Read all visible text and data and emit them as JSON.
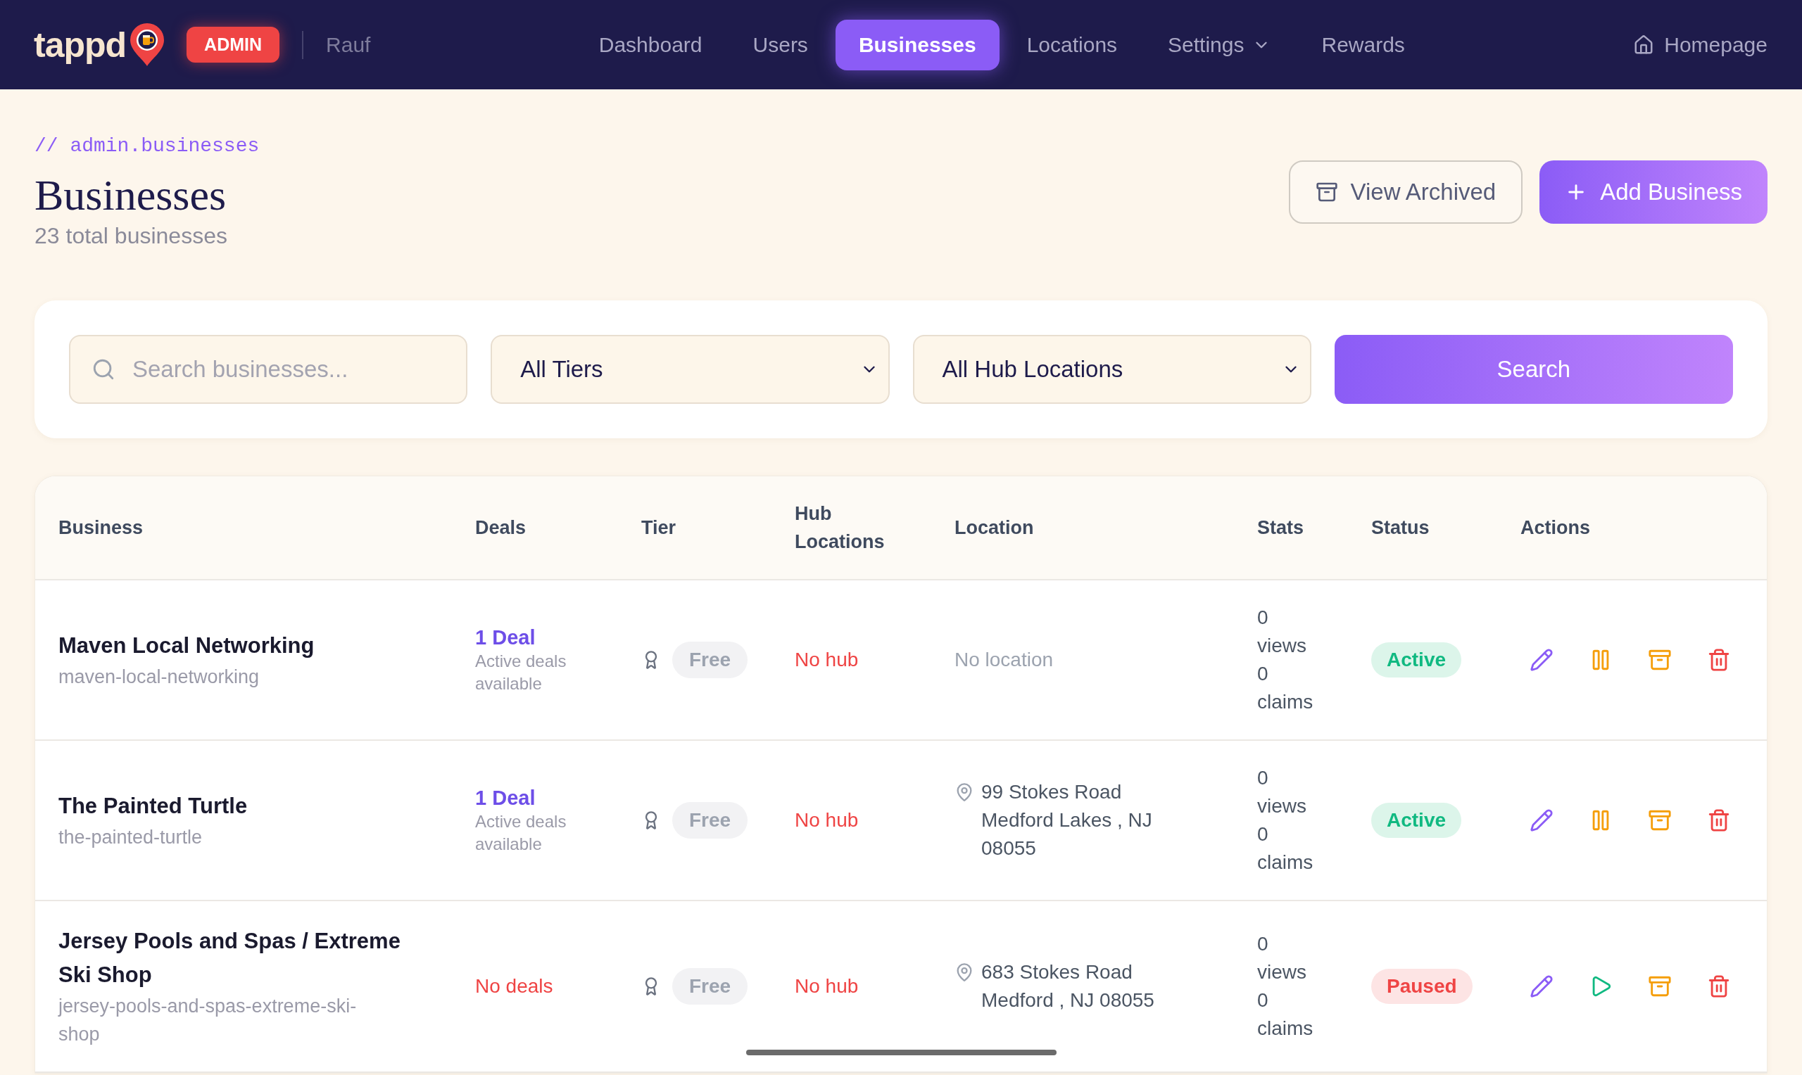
{
  "header": {
    "logo": "tappd",
    "role_badge": "ADMIN",
    "user_name": "Rauf",
    "nav": [
      {
        "label": "Dashboard",
        "selected": false,
        "kind": "link"
      },
      {
        "label": "Users",
        "selected": false,
        "kind": "link"
      },
      {
        "label": "Businesses",
        "selected": true,
        "kind": "link"
      },
      {
        "label": "Locations",
        "selected": false,
        "kind": "link"
      },
      {
        "label": "Settings",
        "selected": false,
        "kind": "menu"
      },
      {
        "label": "Rewards",
        "selected": false,
        "kind": "link"
      }
    ],
    "homepage_link": "Homepage"
  },
  "page": {
    "breadcrumb": "// admin.businesses",
    "title": "Businesses",
    "subtitle": "23 total businesses",
    "actions": [
      {
        "label": "View Archived",
        "kind": "secondary"
      },
      {
        "label": "Add Business",
        "kind": "primary"
      }
    ]
  },
  "filters": {
    "search": {
      "placeholder": "Search businesses..."
    },
    "selects": [
      {
        "value": "All Tiers"
      },
      {
        "value": "All Hub Locations"
      }
    ],
    "submit": "Search"
  },
  "table": {
    "columns": [
      "Business",
      "Deals",
      "Tier",
      "Hub Locations",
      "Location",
      "Stats",
      "Status",
      "Actions"
    ],
    "rows": [
      {
        "name": "Maven Local Networking",
        "slug": "maven-local-networking",
        "deals": {
          "kind": "count",
          "count": "1 Deal",
          "note": "Active deals available"
        },
        "tier": "Free",
        "hub": "No hub",
        "location": {
          "kind": "none",
          "text": "No location"
        },
        "stats": "0 views 0 claims",
        "status": {
          "label": "Active",
          "kind": "active"
        }
      },
      {
        "name": "The Painted Turtle",
        "slug": "the-painted-turtle",
        "deals": {
          "kind": "count",
          "count": "1 Deal",
          "note": "Active deals available"
        },
        "tier": "Free",
        "hub": "No hub",
        "location": {
          "kind": "address",
          "lines": [
            "99 Stokes Road",
            "Medford Lakes , NJ 08055"
          ]
        },
        "stats": "0 views 0 claims",
        "status": {
          "label": "Active",
          "kind": "active"
        }
      },
      {
        "name": "Jersey Pools and Spas / Extreme Ski Shop",
        "slug": "jersey-pools-and-spas-extreme-ski-shop",
        "deals": {
          "kind": "none",
          "text": "No deals"
        },
        "tier": "Free",
        "hub": "No hub",
        "location": {
          "kind": "address",
          "lines": [
            "683 Stokes Road",
            "Medford , NJ 08055"
          ]
        },
        "stats": "0 views 0 claims",
        "status": {
          "label": "Paused",
          "kind": "paused"
        }
      }
    ]
  }
}
